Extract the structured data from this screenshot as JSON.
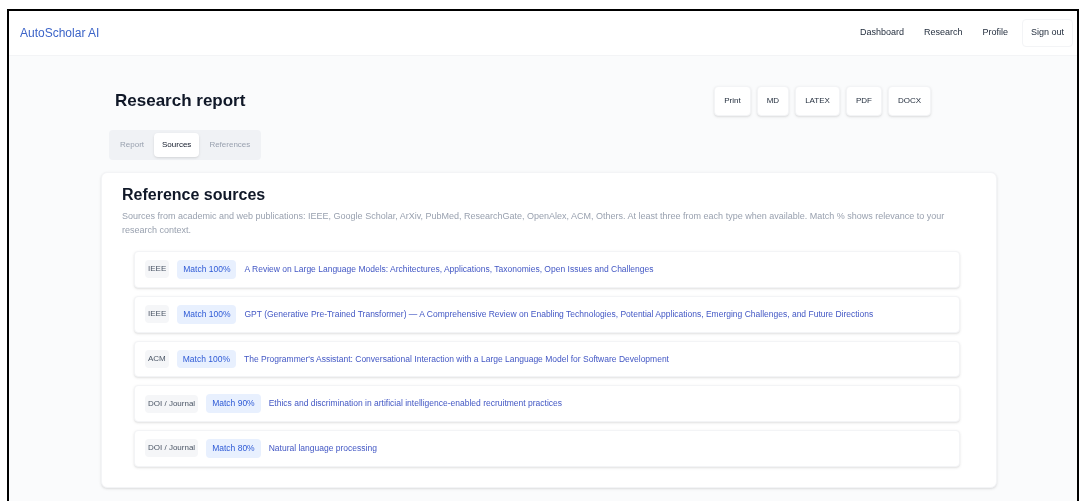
{
  "nav": {
    "brand": "AutoScholar AI",
    "links": [
      {
        "label": "Dashboard",
        "kind": "link"
      },
      {
        "label": "Research",
        "kind": "link"
      },
      {
        "label": "Profile",
        "kind": "link"
      },
      {
        "label": "Sign out",
        "kind": "button"
      }
    ]
  },
  "header": {
    "title": "Research report",
    "exports": [
      "Print",
      "MD",
      "LATEX",
      "PDF",
      "DOCX"
    ]
  },
  "tabs": [
    {
      "label": "Report",
      "selected": false
    },
    {
      "label": "Sources",
      "selected": true
    },
    {
      "label": "References",
      "selected": false
    }
  ],
  "card": {
    "title": "Reference sources",
    "description": "Sources from academic and web publications: IEEE, Google Scholar, ArXiv, PubMed, ResearchGate, OpenAlex, ACM, Others. At least three from each type when available. Match % shows relevance to your research context.",
    "sources": [
      {
        "type": "IEEE",
        "match": "Match 100%",
        "title": "A Review on Large Language Models: Architectures, Applications, Taxonomies, Open Issues and Challenges"
      },
      {
        "type": "IEEE",
        "match": "Match 100%",
        "title": "GPT (Generative Pre-Trained Transformer) — A Comprehensive Review on Enabling Technologies, Potential Applications, Emerging Challenges, and Future Directions"
      },
      {
        "type": "ACM",
        "match": "Match 100%",
        "title": "The Programmer's Assistant: Conversational Interaction with a Large Language Model for Software Development"
      },
      {
        "type": "DOI / Journal",
        "match": "Match 90%",
        "title": "Ethics and discrimination in artificial intelligence-enabled recruitment practices"
      },
      {
        "type": "DOI / Journal",
        "match": "Match 80%",
        "title": "Natural language processing"
      }
    ]
  }
}
